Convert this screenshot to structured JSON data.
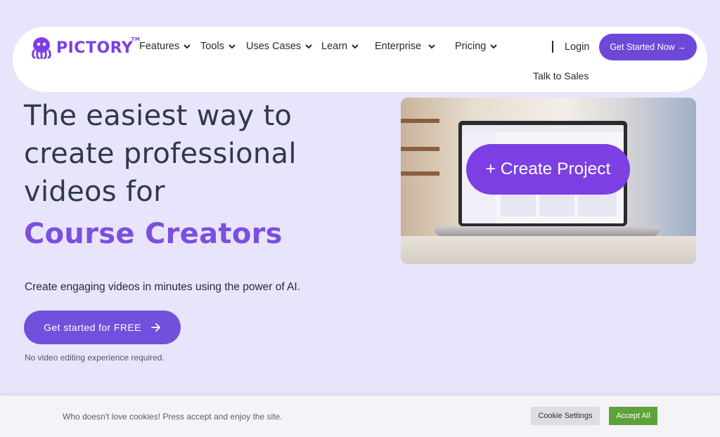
{
  "nav": {
    "logo_text": "PICTORY",
    "logo_tm": "TM",
    "items": [
      {
        "label": "Features"
      },
      {
        "label": "Tools"
      },
      {
        "label": "Uses Cases"
      },
      {
        "label": "Learn"
      },
      {
        "label": "Enterprise"
      },
      {
        "label": "Pricing"
      }
    ],
    "login": "Login",
    "cta": "Get Started Now →",
    "talk_to_sales": "Talk to Sales"
  },
  "hero": {
    "headline_lines": [
      "The easiest way to",
      "create professional",
      "videos for"
    ],
    "headline_accent": "Course Creators",
    "subtitle": "Create engaging videos in minutes using the power of AI.",
    "cta": "Get started for FREE",
    "note": "No video editing experience required.",
    "image_overlay": "+ Create Project"
  },
  "cookie": {
    "text": "Who doesn't love cookies! Press accept and enjoy the site.",
    "settings": "Cookie Settings",
    "accept": "Accept All"
  },
  "colors": {
    "background": "#e8e4fb",
    "brand": "#7b3fe4",
    "cta": "#6e48d9",
    "accept": "#5fa13a"
  }
}
